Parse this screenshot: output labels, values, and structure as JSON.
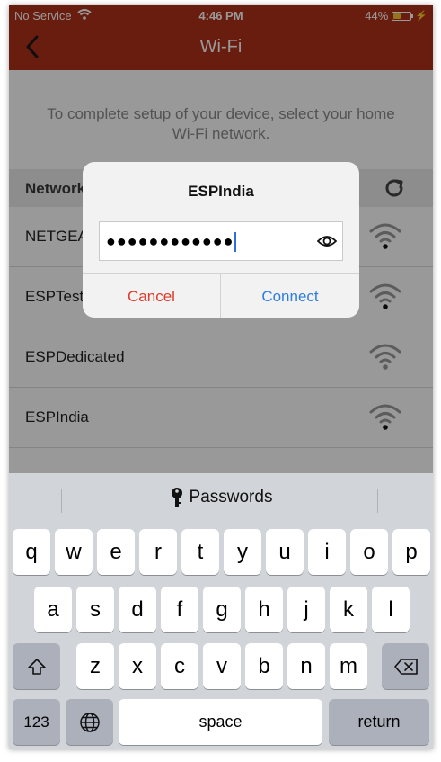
{
  "status_bar": {
    "carrier": "No Service",
    "time": "4:46 PM",
    "battery_percent": "44%",
    "battery_level": 0.44,
    "battery_color": "#f4c430"
  },
  "nav": {
    "title": "Wi-Fi",
    "back_icon": "chevron-left-icon"
  },
  "page": {
    "instruction": "To complete setup of your device, select your home Wi-Fi network.",
    "section_label": "Networks",
    "networks": [
      {
        "name": "NETGEAR"
      },
      {
        "name": "ESPTest"
      },
      {
        "name": "ESPDedicated"
      },
      {
        "name": "ESPIndia"
      }
    ]
  },
  "dialog": {
    "title": "ESPIndia",
    "password_value": "●●●●●●●●●●●●",
    "cancel_label": "Cancel",
    "connect_label": "Connect"
  },
  "keyboard": {
    "suggestion": "Passwords",
    "row1": [
      "q",
      "w",
      "e",
      "r",
      "t",
      "y",
      "u",
      "i",
      "o",
      "p"
    ],
    "row2": [
      "a",
      "s",
      "d",
      "f",
      "g",
      "h",
      "j",
      "k",
      "l"
    ],
    "row3": [
      "z",
      "x",
      "c",
      "v",
      "b",
      "n",
      "m"
    ],
    "numbers_label": "123",
    "space_label": "space",
    "return_label": "return"
  },
  "colors": {
    "brand": "#b0311a",
    "cancel": "#e03a2c",
    "connect": "#2d7de0"
  }
}
